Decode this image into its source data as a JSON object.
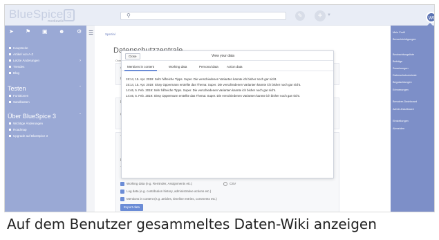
{
  "logo": {
    "text": "BlueSpice",
    "version": "3",
    "subtitle": "mediawiki"
  },
  "topbar": {
    "search_placeholder": "",
    "user_initials": "WI"
  },
  "sidebar": {
    "items_top": [
      {
        "label": "Hauptseite"
      },
      {
        "label": "Artikel von A-Z"
      },
      {
        "label": "Letzte Änderungen"
      },
      {
        "label": "Trendes"
      },
      {
        "label": "Blog"
      }
    ],
    "group1": {
      "title": "Testen",
      "items": [
        {
          "label": "Funktionen"
        },
        {
          "label": "Sandkasten"
        }
      ]
    },
    "group2": {
      "title": "Über BlueSpice 3",
      "items": [
        {
          "label": "Wichtige Änderungen"
        },
        {
          "label": "Roadmap"
        },
        {
          "label": "Upgrade auf BlueSpice 3"
        }
      ]
    }
  },
  "content": {
    "breadcrumb": "Spezial",
    "title": "Datenschutzzentrale",
    "overview": "Overv",
    "labels": [
      "Ar",
      "Re",
      "Da",
      "Ch",
      "To",
      "Ex",
      "Tc"
    ],
    "checkboxes": [
      {
        "label": "Working data (e.g. Reminder, Assignments etc.)"
      },
      {
        "label": "Log data (e.g. contribution history, administrative actions etc.)"
      },
      {
        "label": "Mentions in content (e.g. articles, timeline entries, comments etc.)"
      }
    ],
    "csv_label": "CSV",
    "export_button": "Export data"
  },
  "modal": {
    "close_label": "Close",
    "title": "View your data",
    "tabs": [
      {
        "label": "Mentions in content"
      },
      {
        "label": "Working data"
      },
      {
        "label": "Personal data"
      },
      {
        "label": "Action data"
      }
    ],
    "entries": [
      "15:14, 15. Apr. 2019: Sehr hilfreiche Tipps. Super. Die verschiedenen Varianten kannte ich bisher noch gar nicht.",
      "15:14, 15. Apr. 2019: Sissy Oppermann erstellte das Thema:  Super. Die verschiedenen Varianten kannte ich bisher noch gar nicht.",
      "14:46, 5. Feb. 2019: Sehr hilfreiche Tipps. Super. Die verschiedenen Varianten kannte ich bisher noch gar nicht.",
      "14:46, 5. Feb. 2019: Sissy Oppermann erstellte das Thema:  Super. Die verschiedenen Varianten kannte ich bisher noch gar nicht."
    ]
  },
  "usermenu": {
    "items": [
      {
        "label": "Mein Profil"
      },
      {
        "label": "Benachrichtigungen"
      },
      {
        "label": "Beobachtungsliste"
      },
      {
        "label": "Beiträge"
      },
      {
        "label": "Zuweisungen"
      },
      {
        "label": "Datenschutzzentrale"
      },
      {
        "label": "Begutachtungen"
      },
      {
        "label": "Erinnerungen"
      },
      {
        "label": "Benutzer-Dashboard"
      },
      {
        "label": "Admin-Dashboard"
      },
      {
        "label": "Einstellungen"
      },
      {
        "label": "Abmelden"
      }
    ]
  },
  "caption": "Auf dem Benutzer gesammeltes Daten-Wiki anzeigen",
  "colors": {
    "sidebar": "#9aa9d5",
    "usermenu": "#7d8fc8",
    "accent": "#6b8cd6"
  }
}
